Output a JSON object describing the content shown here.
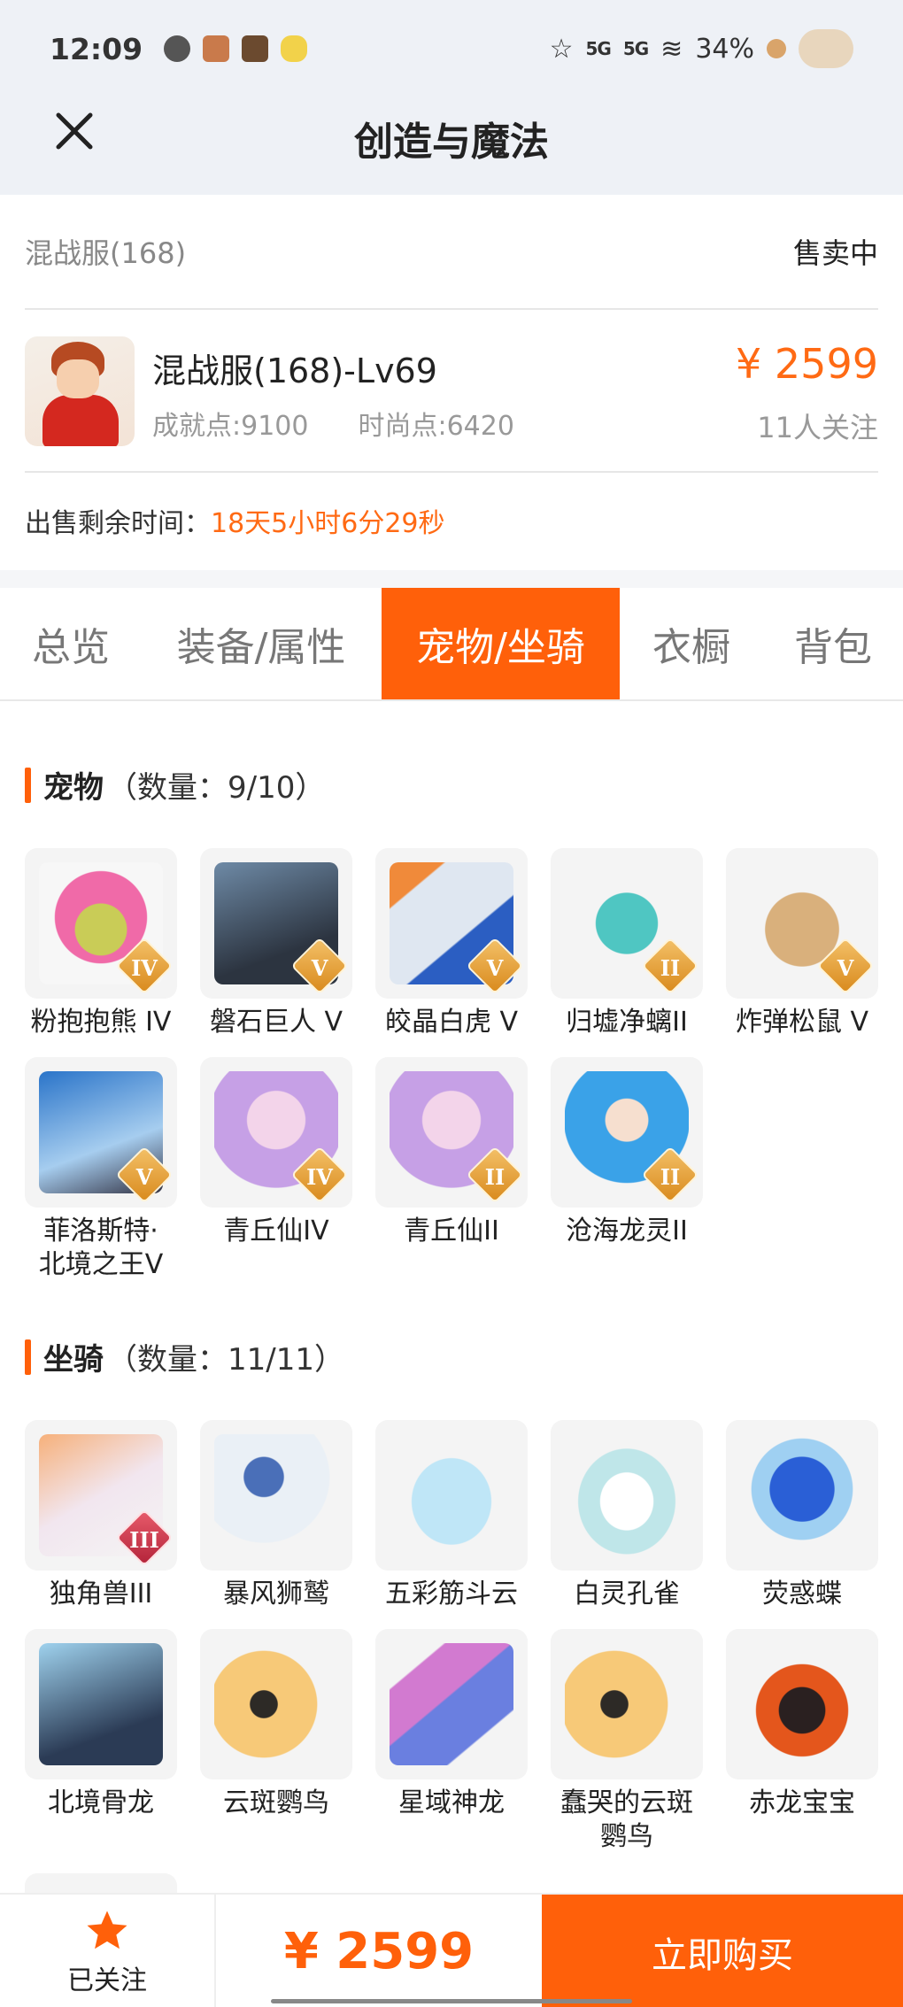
{
  "status_bar": {
    "time": "12:09",
    "signal1": "5G",
    "signal2": "5G",
    "battery": "34%"
  },
  "header": {
    "title": "创造与魔法"
  },
  "listing": {
    "server": "混战服(168)",
    "sale_status": "售卖中",
    "role_name": "混战服(168)-Lv69",
    "achievement": "成就点:9100",
    "fashion": "时尚点:6420",
    "price": "¥ 2599",
    "followers": "11人关注",
    "remain_label": "出售剩余时间：",
    "remain_value": "18天5小时6分29秒"
  },
  "tabs": [
    {
      "label": "总览"
    },
    {
      "label": "装备/属性"
    },
    {
      "label": "宠物/坐骑",
      "active": true
    },
    {
      "label": "衣橱"
    },
    {
      "label": "背包"
    }
  ],
  "pets": {
    "label": "宠物",
    "count": "（数量：9/10）",
    "items": [
      {
        "name": "粉抱抱熊 IV",
        "badge": "IV"
      },
      {
        "name": "磐石巨人 V",
        "badge": "V"
      },
      {
        "name": "皎晶白虎 V",
        "badge": "V"
      },
      {
        "name": "归墟净螭II",
        "badge": "II"
      },
      {
        "name": "炸弹松鼠 V",
        "badge": "V"
      },
      {
        "name": "菲洛斯特·北境之王V",
        "line1": "菲洛斯特·",
        "line2": "北境之王V",
        "badge": "V"
      },
      {
        "name": "青丘仙IV",
        "badge": "IV"
      },
      {
        "name": "青丘仙II",
        "badge": "II"
      },
      {
        "name": "沧海龙灵II",
        "badge": "II"
      }
    ]
  },
  "mounts": {
    "label": "坐骑",
    "count": "（数量：11/11）",
    "items": [
      {
        "name": "独角兽III",
        "badge": "III"
      },
      {
        "name": "暴风狮鹫"
      },
      {
        "name": "五彩筋斗云"
      },
      {
        "name": "白灵孔雀"
      },
      {
        "name": "荧惑蝶"
      },
      {
        "name": "北境骨龙"
      },
      {
        "name": "云斑鹦鸟"
      },
      {
        "name": "星域神龙"
      },
      {
        "name": "蠢哭的云斑鹦鸟",
        "line1": "蠢哭的云斑",
        "line2": "鹦鸟"
      },
      {
        "name": "赤龙宝宝"
      }
    ]
  },
  "bottom_bar": {
    "follow_label": "已关注",
    "price": "¥ 2599",
    "buy_label": "立即购买"
  }
}
